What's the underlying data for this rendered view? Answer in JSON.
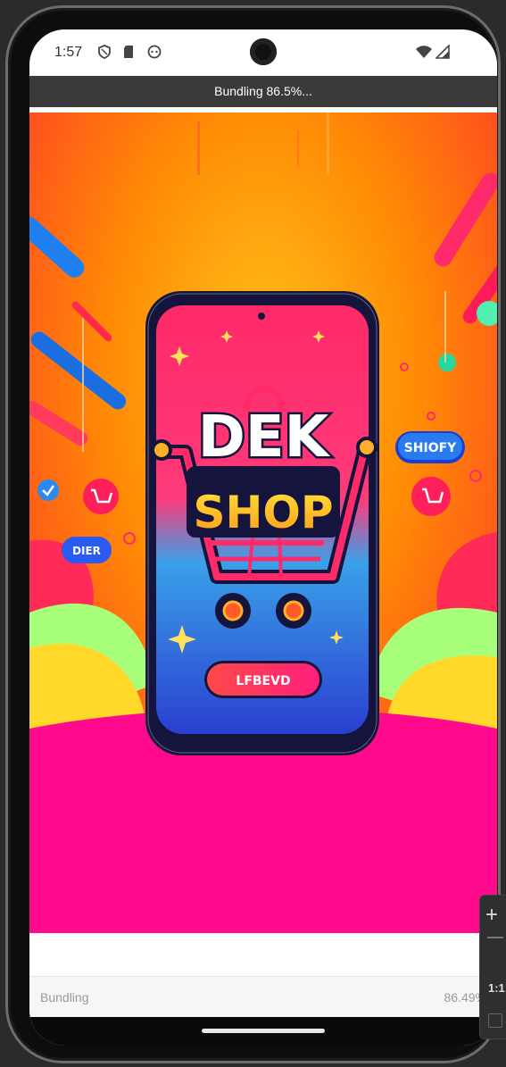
{
  "status_bar": {
    "time": "1:57"
  },
  "bundling_banner": {
    "text": "Bundling 86.5%..."
  },
  "splash": {
    "logo_top": "DEK",
    "logo_bottom": "SHOP",
    "button_text": "LFBEVD",
    "tag_right": "SHIOFY",
    "tag_left": "DIER"
  },
  "footer": {
    "label": "Bundling",
    "percent": "86.49%"
  },
  "zoom_controls": {
    "zoom_in": "+",
    "ratio": "1:1"
  },
  "colors": {
    "accent_pink": "#ff1a8c",
    "accent_orange": "#ff8a00",
    "phone_navy": "#14143c"
  }
}
